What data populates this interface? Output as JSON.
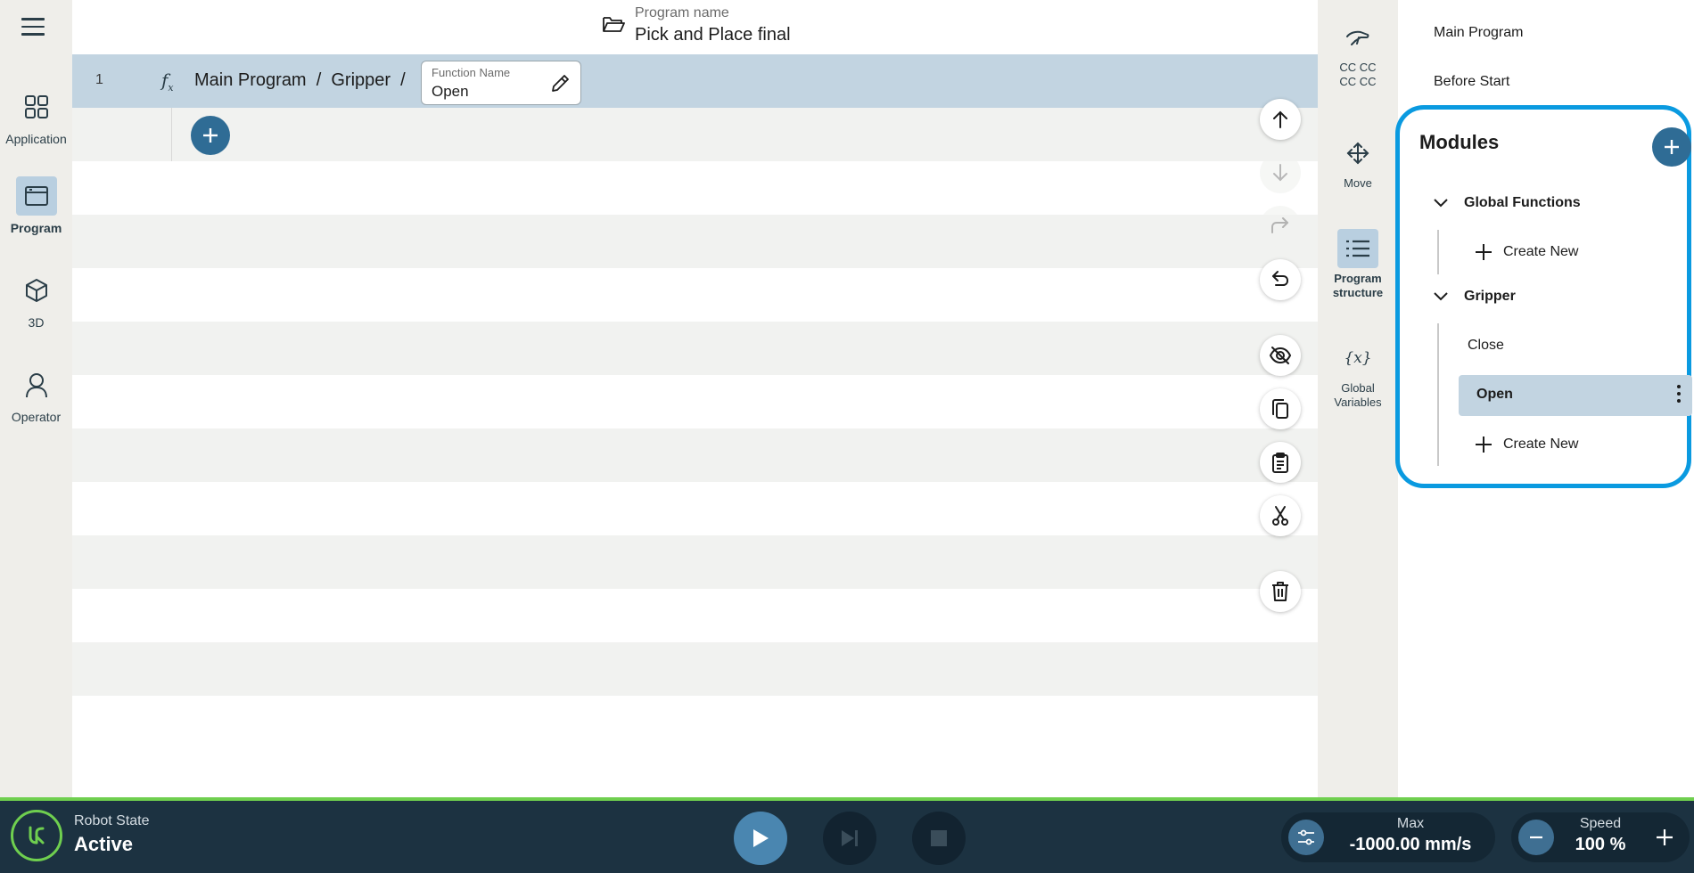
{
  "header": {
    "program_name_label": "Program name",
    "program_name": "Pick and Place final"
  },
  "leftnav": {
    "items": [
      {
        "label": "Application",
        "icon": "grid-icon"
      },
      {
        "label": "Program",
        "icon": "window-icon",
        "active": true
      },
      {
        "label": "3D",
        "icon": "cube-icon"
      },
      {
        "label": "Operator",
        "icon": "person-icon"
      }
    ]
  },
  "editor": {
    "line_number": "1",
    "fx_symbol": "f",
    "fx_sub": "x",
    "breadcrumb": "Main Program  /  Gripper  /",
    "function_name_label": "Function Name",
    "function_name_value": "Open"
  },
  "sidetools": {
    "items": [
      {
        "label1": "CC CC",
        "label2": "CC CC",
        "icon": "hand-icon"
      },
      {
        "label1": "Move",
        "label2": "",
        "icon": "move-arrows-icon"
      },
      {
        "label1": "Program",
        "label2": "structure",
        "icon": "list-icon",
        "active": true
      },
      {
        "label1": "Global",
        "label2": "Variables",
        "icon": "variable-icon"
      }
    ]
  },
  "rightpanel": {
    "main_program": "Main Program",
    "before_start": "Before Start",
    "modules_title": "Modules",
    "global_functions": "Global Functions",
    "create_new": "Create New",
    "gripper": "Gripper",
    "close_fn": "Close",
    "open_fn": "Open"
  },
  "bottombar": {
    "robot_state_label": "Robot State",
    "robot_state_value": "Active",
    "max_label": "Max",
    "max_value": "-1000.00 mm/s",
    "speed_label": "Speed",
    "speed_value": "100 %"
  },
  "colors": {
    "accent": "#2f6c95",
    "highlight": "#0a9ae0",
    "status_green": "#6fcf4f",
    "selected_row": "#c2d4e1"
  }
}
